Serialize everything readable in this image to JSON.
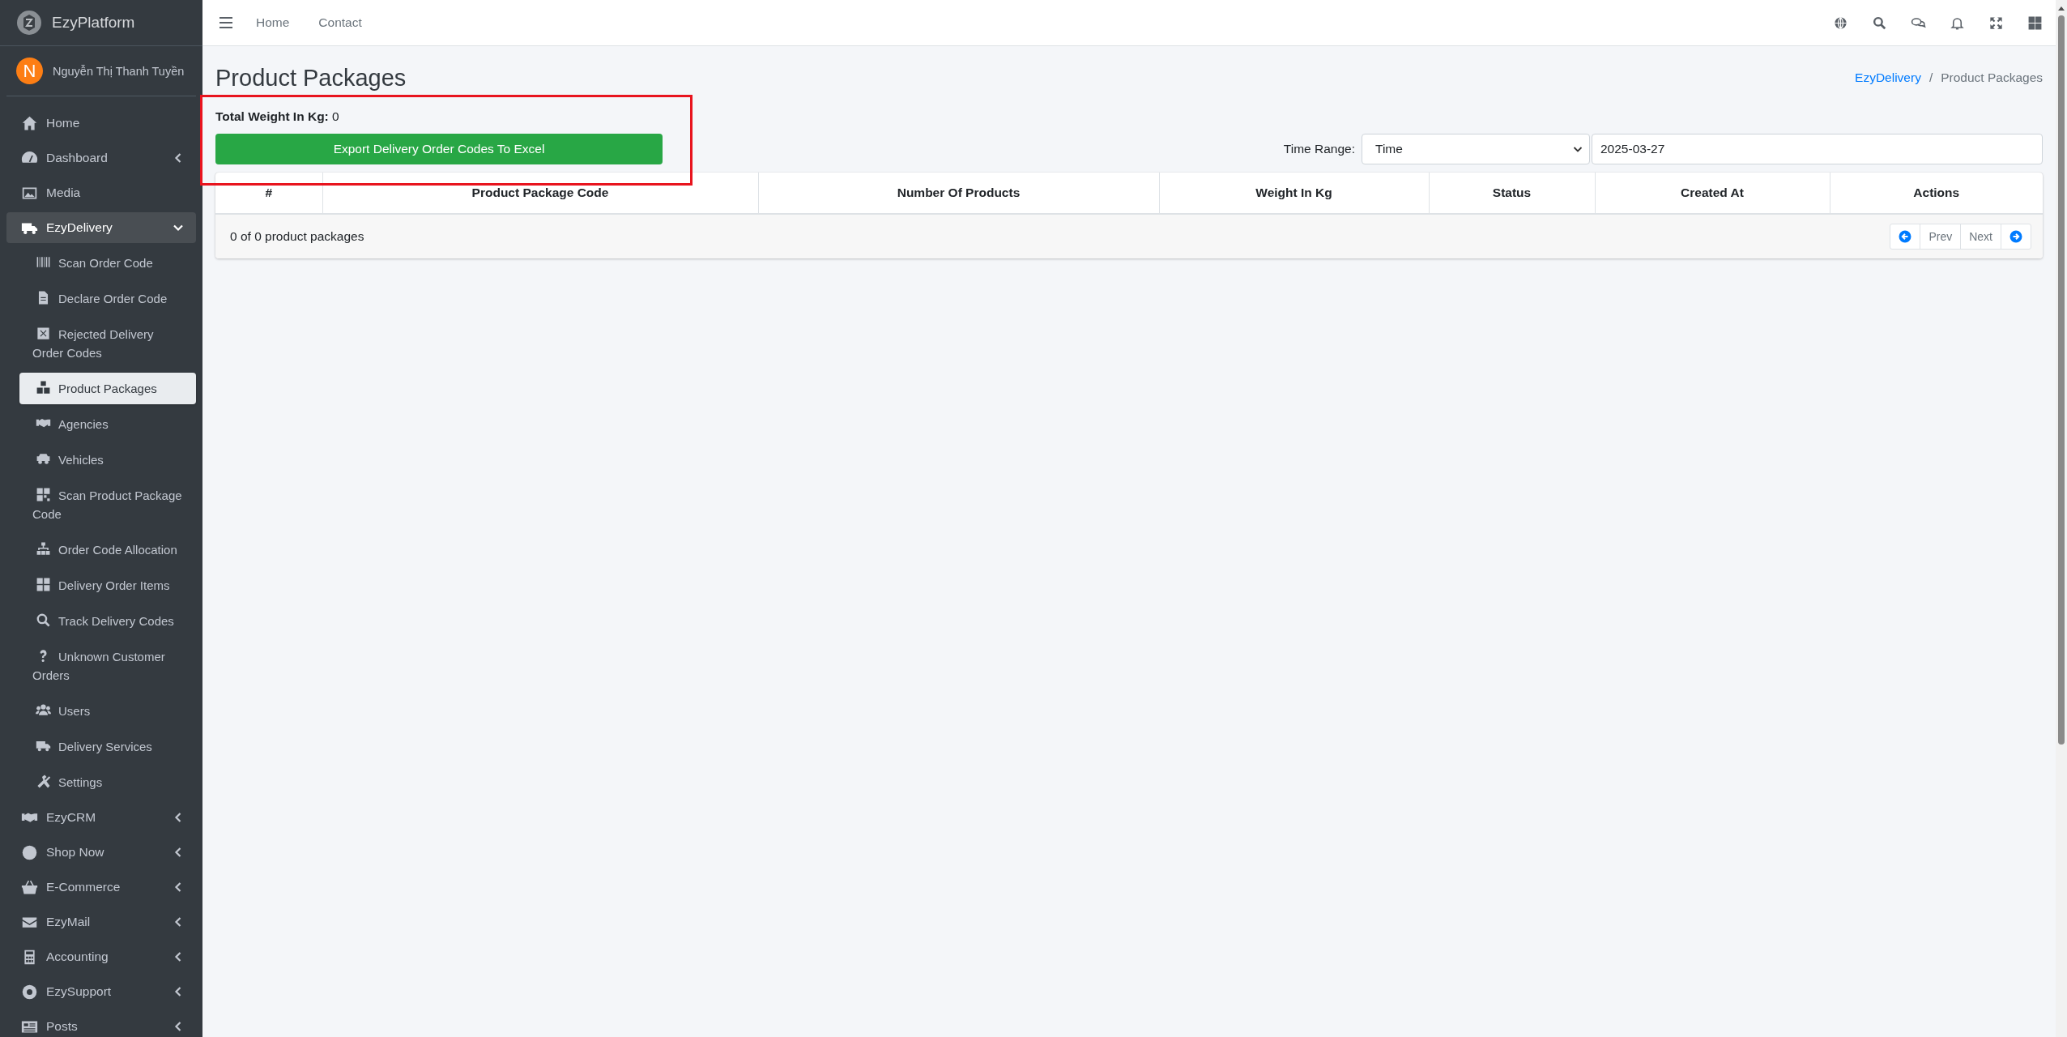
{
  "brand": {
    "name": "EzyPlatform"
  },
  "user": {
    "initial": "N",
    "name": "Nguyễn Thị Thanh Tuyền"
  },
  "sidebar": {
    "items": [
      {
        "label": "Home",
        "kind": "link",
        "selected": false
      },
      {
        "label": "Dashboard",
        "kind": "group",
        "selected": false,
        "expanded": false
      },
      {
        "label": "Media",
        "kind": "link",
        "selected": false
      },
      {
        "label": "EzyDelivery",
        "kind": "group",
        "selected": true,
        "expanded": true,
        "children": [
          {
            "label": "Scan Order Code",
            "selected": false
          },
          {
            "label": "Declare Order Code",
            "selected": false
          },
          {
            "label": "Rejected Delivery Order Codes",
            "selected": false
          },
          {
            "label": "Product Packages",
            "selected": true
          },
          {
            "label": "Agencies",
            "selected": false
          },
          {
            "label": "Vehicles",
            "selected": false
          },
          {
            "label": "Scan Product Package Code",
            "selected": false
          },
          {
            "label": "Order Code Allocation",
            "selected": false
          },
          {
            "label": "Delivery Order Items",
            "selected": false
          },
          {
            "label": "Track Delivery Codes",
            "selected": false
          },
          {
            "label": "Unknown Customer Orders",
            "selected": false
          },
          {
            "label": "Users",
            "selected": false
          },
          {
            "label": "Delivery Services",
            "selected": false
          },
          {
            "label": "Settings",
            "selected": false
          }
        ]
      },
      {
        "label": "EzyCRM",
        "kind": "group",
        "selected": false,
        "expanded": false
      },
      {
        "label": "Shop Now",
        "kind": "group",
        "selected": false,
        "expanded": false
      },
      {
        "label": "E-Commerce",
        "kind": "group",
        "selected": false,
        "expanded": false
      },
      {
        "label": "EzyMail",
        "kind": "group",
        "selected": false,
        "expanded": false
      },
      {
        "label": "Accounting",
        "kind": "group",
        "selected": false,
        "expanded": false
      },
      {
        "label": "EzySupport",
        "kind": "group",
        "selected": false,
        "expanded": false
      },
      {
        "label": "Posts",
        "kind": "group",
        "selected": false,
        "expanded": false
      }
    ]
  },
  "topbar": {
    "nav": [
      "Home",
      "Contact"
    ]
  },
  "page": {
    "title": "Product Packages",
    "breadcrumb": {
      "separator": "/",
      "items": [
        {
          "label": "EzyDelivery",
          "kind": "link"
        },
        {
          "label": "Product Packages",
          "kind": "current"
        }
      ]
    },
    "summary": {
      "label": "Total Weight In Kg:",
      "value": "0"
    },
    "export_button": "Export Delivery Order Codes To Excel",
    "filter": {
      "label": "Time Range:",
      "select": "Time",
      "date": "2025-03-27"
    },
    "table": {
      "columns": [
        "#",
        "Product Package Code",
        "Number Of Products",
        "Weight In Kg",
        "Status",
        "Created At",
        "Actions"
      ],
      "footer": "0 of 0 product packages",
      "pagination": {
        "prev": "Prev",
        "next": "Next"
      }
    }
  }
}
